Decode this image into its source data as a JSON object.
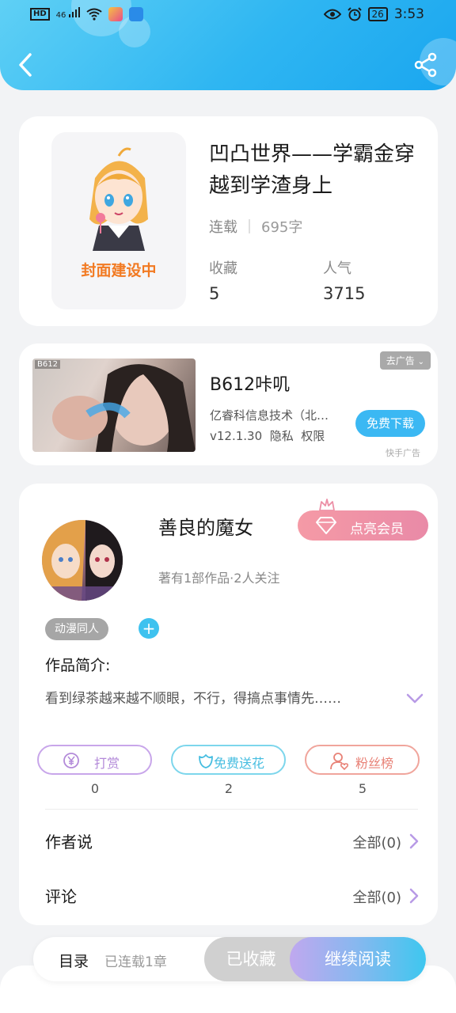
{
  "status_bar": {
    "network": "HD",
    "signal": "46",
    "battery": "26",
    "time": "3:53"
  },
  "book": {
    "title": "凹凸世界——学霸金穿越到学渣身上",
    "cover_caption": "封面建设中",
    "status": "连载",
    "word_count": "695字",
    "favorites_label": "收藏",
    "favorites_value": "5",
    "popularity_label": "人气",
    "popularity_value": "3715"
  },
  "ad": {
    "thumb_tag": "B612",
    "close_label": "去广告",
    "title": "B612咔叽",
    "company": "亿睿科信息技术（北…",
    "version": "v12.1.30",
    "privacy": "隐私",
    "permissions": "权限",
    "download_label": "免费下载",
    "source": "快手广告"
  },
  "author": {
    "name": "善良的魔女",
    "vip_label": "点亮会员",
    "info": "著有1部作品·2人关注",
    "tag": "动漫同人",
    "add_tag": "+",
    "intro_label": "作品简介:",
    "intro_text": "看到绿茶越来越不顺眼，不行，得搞点事情先……"
  },
  "actions": [
    {
      "label": "打赏",
      "count": "0",
      "icon": "yen-coin-icon",
      "color": "#b38ad9"
    },
    {
      "label": "免费送花",
      "count": "2",
      "icon": "flower-icon",
      "color": "#46bde0"
    },
    {
      "label": "粉丝榜",
      "count": "5",
      "icon": "fans-icon",
      "color": "#e88277"
    }
  ],
  "rows": [
    {
      "label": "作者说",
      "value": "全部(0)"
    },
    {
      "label": "评论",
      "value": "全部(0)"
    }
  ],
  "bottom_bar": {
    "toc_label": "目录",
    "chapters": "已连载1章",
    "collected_label": "已收藏",
    "read_label": "继续阅读"
  },
  "colors": {
    "header": "#2fb6f2",
    "accent_blue": "#3ec2ef",
    "vip_pink": "#ec8fa6",
    "cover_caption": "#f27a22"
  }
}
